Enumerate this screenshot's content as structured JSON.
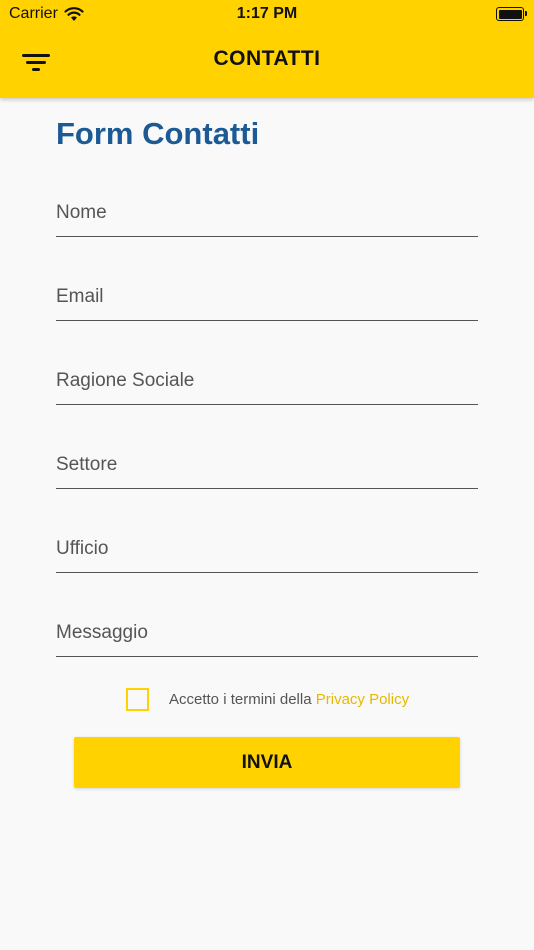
{
  "status_bar": {
    "carrier": "Carrier",
    "time": "1:17 PM",
    "wifi_icon": "wifi-icon",
    "battery_icon": "battery-icon"
  },
  "header": {
    "menu_icon": "filter-menu-icon",
    "title": "CONTATTI",
    "background_color": "#ffd200"
  },
  "form": {
    "title": "Form Contatti",
    "title_color": "#1c5a96",
    "fields": [
      {
        "name": "nome",
        "placeholder": "Nome",
        "value": ""
      },
      {
        "name": "email",
        "placeholder": "Email",
        "value": ""
      },
      {
        "name": "ragione-sociale",
        "placeholder": "Ragione Sociale",
        "value": ""
      },
      {
        "name": "settore",
        "placeholder": "Settore",
        "value": ""
      },
      {
        "name": "ufficio",
        "placeholder": "Ufficio",
        "value": ""
      },
      {
        "name": "messaggio",
        "placeholder": "Messaggio",
        "value": ""
      }
    ],
    "privacy": {
      "checked": false,
      "text": "Accetto i termini della",
      "link_text": "Privacy Policy",
      "link_color": "#e6b800"
    },
    "submit_label": "INVIA"
  }
}
